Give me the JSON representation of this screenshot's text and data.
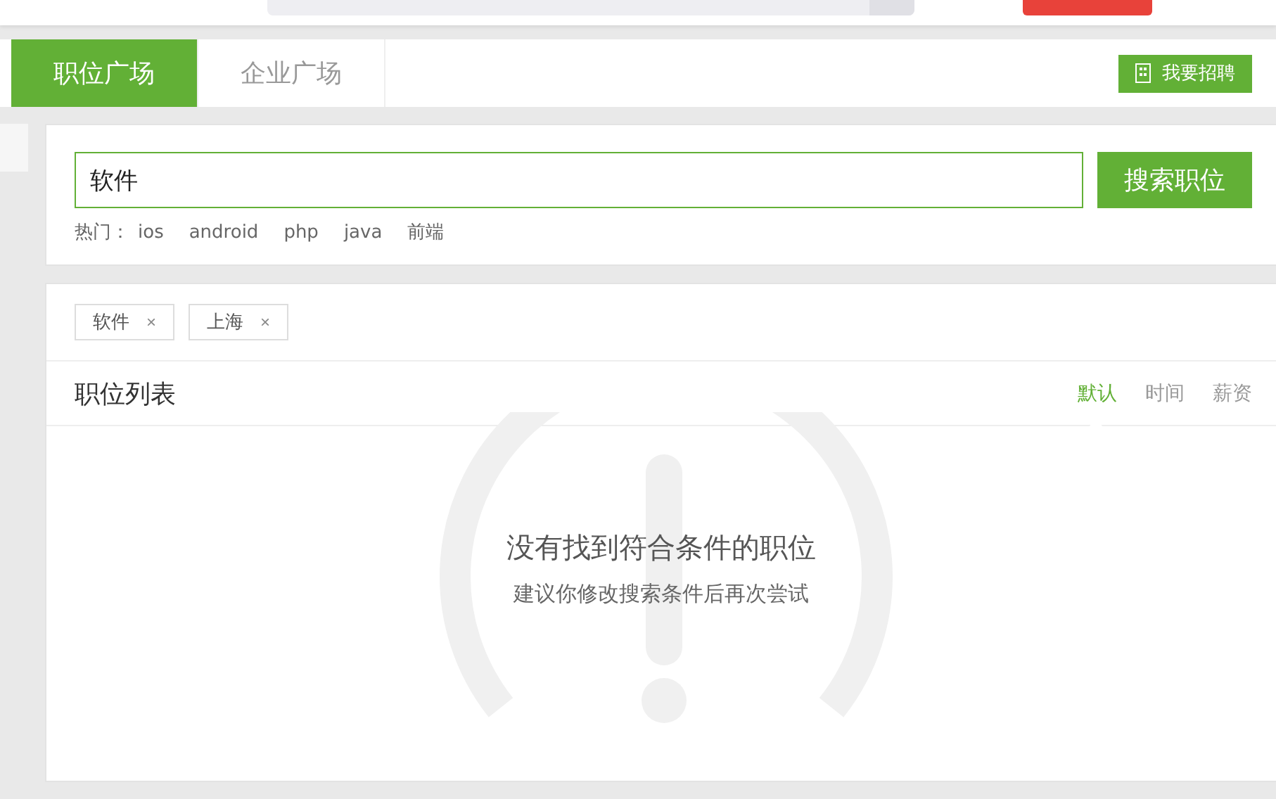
{
  "tabs": [
    {
      "label": "职位广场",
      "selected": true
    },
    {
      "label": "企业广场",
      "selected": false
    }
  ],
  "recruit_button": "我要招聘",
  "search": {
    "value": "软件",
    "button": "搜索职位",
    "hot_label": "热门：",
    "hot": [
      "ios",
      "android",
      "php",
      "java",
      "前端"
    ]
  },
  "filters": [
    {
      "label": "软件",
      "remove": "×"
    },
    {
      "label": "上海",
      "remove": "×"
    }
  ],
  "list": {
    "title": "职位列表",
    "sorts": [
      {
        "label": "默认",
        "selected": true
      },
      {
        "label": "时间",
        "selected": false
      },
      {
        "label": "薪资",
        "selected": false
      }
    ]
  },
  "empty": {
    "title": "没有找到符合条件的职位",
    "hint": "建议你修改搜索条件后再次尝试"
  }
}
